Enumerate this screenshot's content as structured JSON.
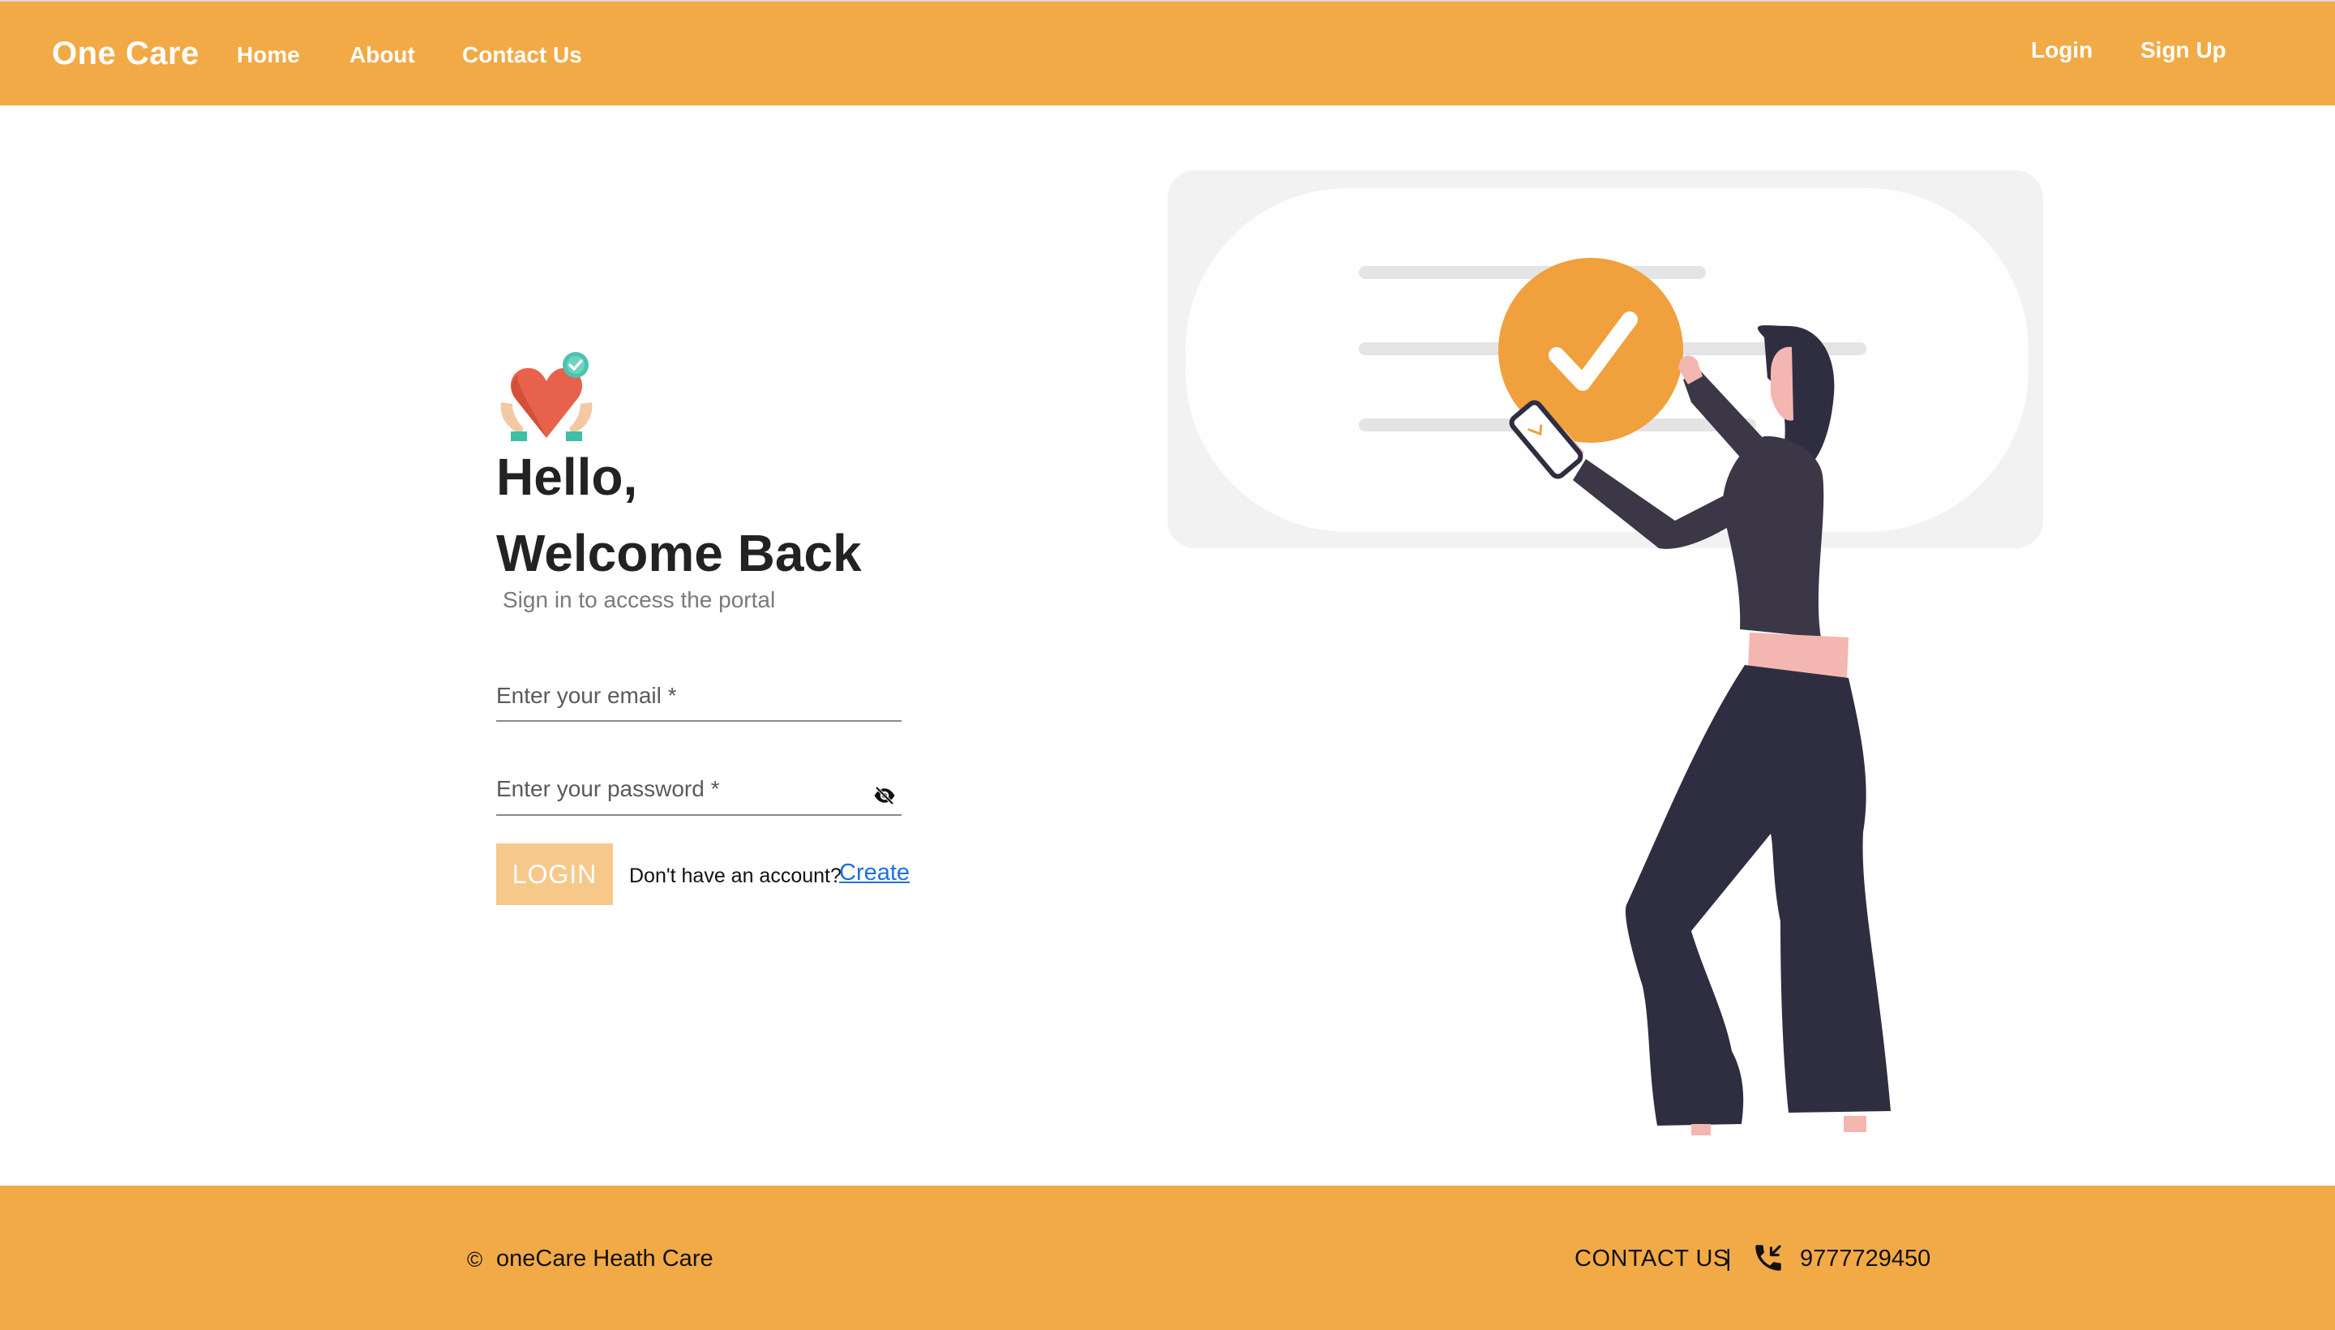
{
  "header": {
    "brand": "One Care",
    "nav": {
      "home": "Home",
      "about": "About",
      "contact": "Contact Us",
      "login": "Login",
      "signup": "Sign Up"
    }
  },
  "login": {
    "greeting": "Hello,",
    "welcome": "Welcome Back",
    "subtitle": "Sign in to access the portal",
    "email_placeholder": "Enter your email *",
    "password_placeholder": "Enter your password *",
    "button_label": "LOGIN",
    "no_account_text": "Don't have an account?",
    "create_link": "Create"
  },
  "footer": {
    "copyright_symbol": "©",
    "copyright_text": "oneCare Heath Care",
    "contact_label": "CONTACT US",
    "separator": "|",
    "phone": "9777729450"
  },
  "icons": {
    "logo": "heart-hands-icon",
    "password_toggle": "eye-off-icon",
    "phone": "phone-incoming-icon",
    "illustration_check": "check-circle-icon"
  },
  "colors": {
    "primary": "#f2aa46",
    "button_disabled": "#f6c98a",
    "link": "#1f6fe0",
    "heading": "#222222",
    "check_circle": "#f0a03c",
    "figure_dark": "#3b3747",
    "figure_skin": "#f3b6b1"
  }
}
